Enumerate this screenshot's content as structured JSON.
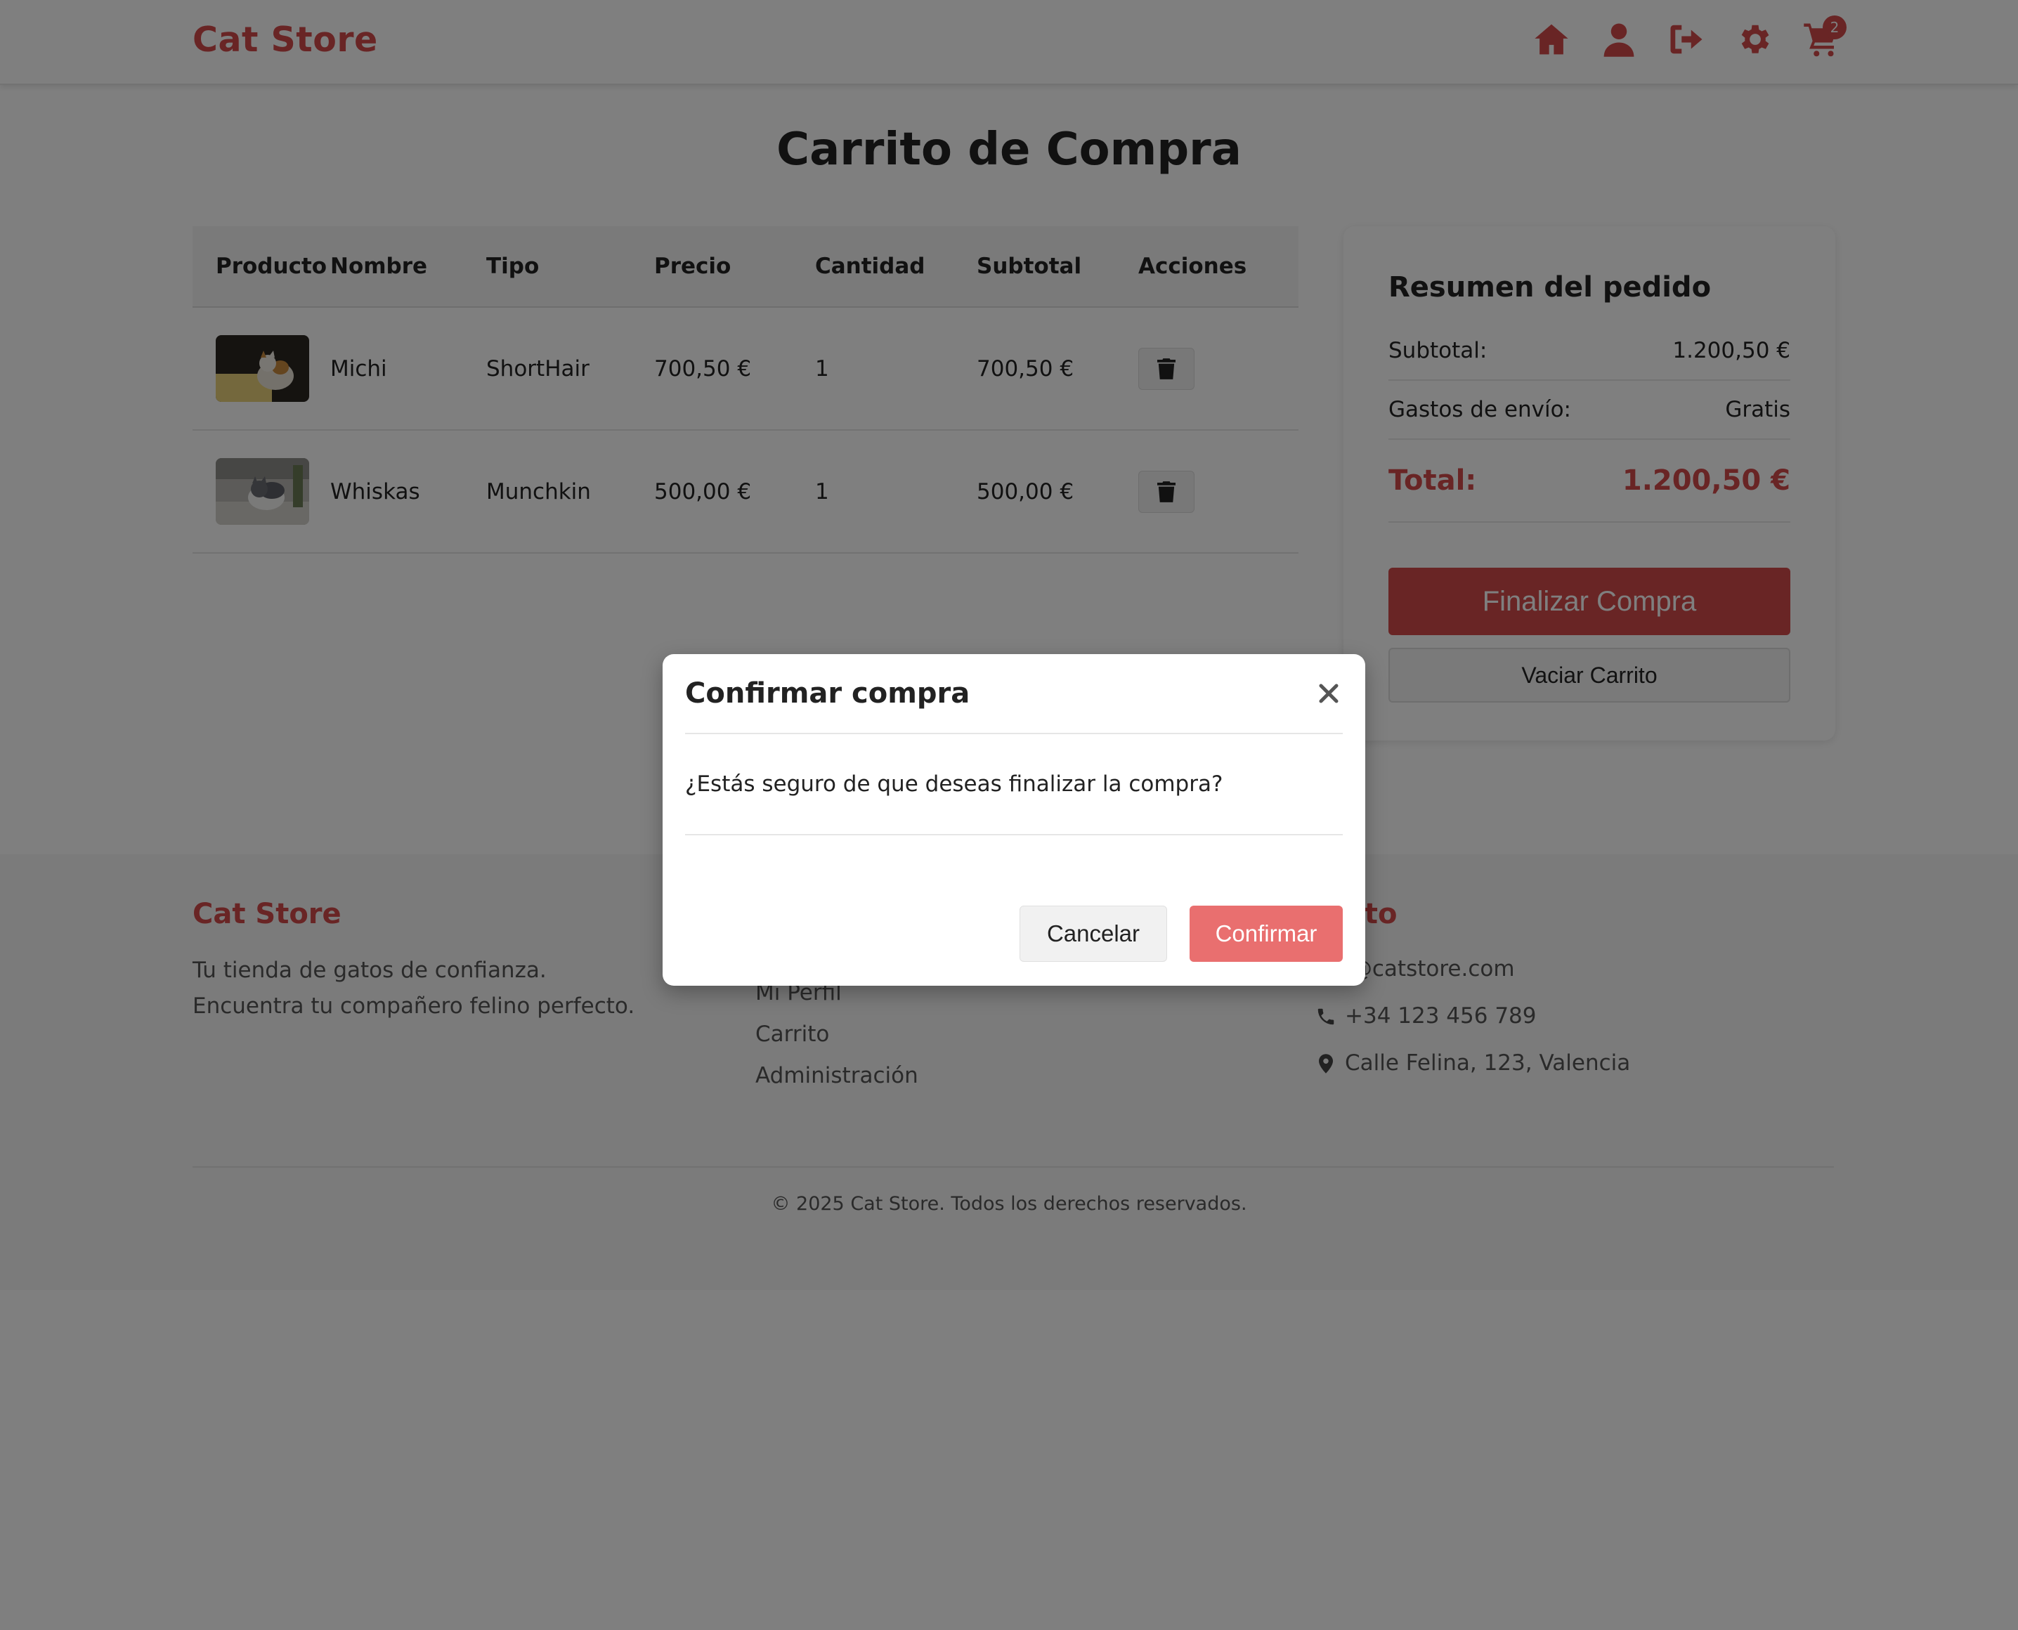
{
  "header": {
    "brand": "Cat Store",
    "icons": [
      "home-icon",
      "user-icon",
      "logout-icon",
      "gear-icon",
      "cart-icon"
    ],
    "cart_count": "2"
  },
  "page": {
    "title": "Carrito de Compra"
  },
  "table": {
    "columns": [
      "Producto",
      "Nombre",
      "Tipo",
      "Precio",
      "Cantidad",
      "Subtotal",
      "Acciones"
    ],
    "rows": [
      {
        "name": "Michi",
        "type": "ShortHair",
        "price": "700,50 €",
        "qty": "1",
        "subtotal": "700,50 €"
      },
      {
        "name": "Whiskas",
        "type": "Munchkin",
        "price": "500,00 €",
        "qty": "1",
        "subtotal": "500,00 €"
      }
    ]
  },
  "summary": {
    "title": "Resumen del pedido",
    "subtotal_label": "Subtotal:",
    "subtotal_value": "1.200,50 €",
    "shipping_label": "Gastos de envío:",
    "shipping_value": "Gratis",
    "total_label": "Total:",
    "total_value": "1.200,50 €",
    "checkout_label": "Finalizar Compra",
    "empty_label": "Vaciar Carrito"
  },
  "footer": {
    "col1_title": "Cat Store",
    "col1_text": "Tu tienda de gatos de confianza. Encuentra tu compañero felino perfecto.",
    "links": [
      "Mi Perfil",
      "Carrito",
      "Administración"
    ],
    "col3_title": "tacto",
    "email": "fo@catstore.com",
    "phone": "+34 123 456 789",
    "address": "Calle Felina, 123, Valencia",
    "copyright": "© 2025 Cat Store. Todos los derechos reservados."
  },
  "modal": {
    "title": "Confirmar compra",
    "message": "¿Estás seguro de que deseas finalizar la compra?",
    "cancel_label": "Cancelar",
    "confirm_label": "Confirmar"
  },
  "colors": {
    "accent": "#d24a4a",
    "confirm": "#e96f6f",
    "overlay": "rgba(0,0,0,0.5)"
  }
}
